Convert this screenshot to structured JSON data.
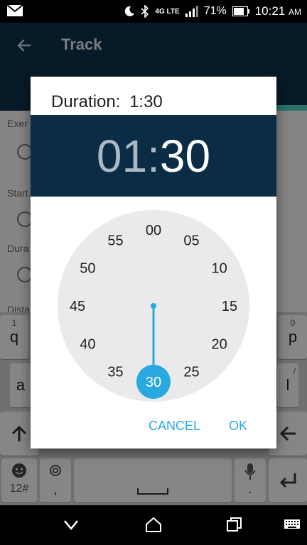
{
  "status_bar": {
    "signal_label": "4G LTE",
    "battery": "71%",
    "time": "10:21",
    "time_suffix": "AM"
  },
  "toolbar": {
    "title": "Track"
  },
  "form": {
    "exercise_label": "Exer",
    "start_label": "Start",
    "duration_label": "Dura",
    "distance_label": "Dista"
  },
  "keyboard": {
    "q": "q",
    "q_hint": "1",
    "p": "p",
    "p_hint": "0",
    "a": "a",
    "l": "l",
    "l_hint": "/",
    "sym": "12#",
    "comma": ",",
    "period": "."
  },
  "dialog": {
    "title_prefix": "Duration:",
    "title_value": "1:30",
    "hours": "01",
    "separator": ":",
    "minutes": "30",
    "clock_labels": [
      "00",
      "05",
      "10",
      "15",
      "20",
      "25",
      "30",
      "35",
      "40",
      "45",
      "50",
      "55"
    ],
    "selected_minute": "30",
    "cancel_label": "CANCEL",
    "ok_label": "OK"
  },
  "colors": {
    "accent": "#29a9e0",
    "header": "#0a2d45",
    "toolbar": "#0d3147"
  }
}
